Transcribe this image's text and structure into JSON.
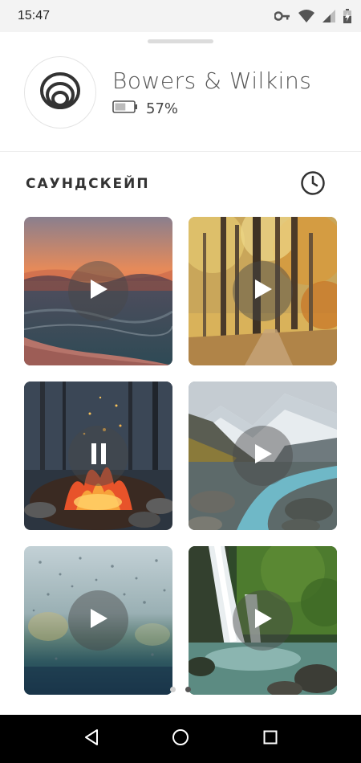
{
  "status_bar": {
    "time": "15:47",
    "icons": [
      "key-icon",
      "wifi-icon",
      "signal-icon",
      "battery-charging-icon"
    ]
  },
  "device": {
    "name": "Bowers & Wilkins",
    "battery_percent_text": "57%",
    "battery_level": 0.57,
    "logo_icon": "bowers-wilkins-logo"
  },
  "section": {
    "title": "САУНДСКЕЙП",
    "history_icon": "clock-icon"
  },
  "soundscapes": [
    {
      "scene": "sunset-sea",
      "state": "play"
    },
    {
      "scene": "autumn-forest",
      "state": "play"
    },
    {
      "scene": "campfire",
      "state": "pause"
    },
    {
      "scene": "mountain-river",
      "state": "play"
    },
    {
      "scene": "rainy-window",
      "state": "play"
    },
    {
      "scene": "waterfall",
      "state": "play"
    }
  ],
  "pager": {
    "pages": 2,
    "active": 2
  },
  "nav": {
    "buttons": [
      "back-icon",
      "home-icon",
      "recents-icon"
    ]
  },
  "colors": {
    "accent_dark": "#333333",
    "play_overlay": "#464646"
  }
}
